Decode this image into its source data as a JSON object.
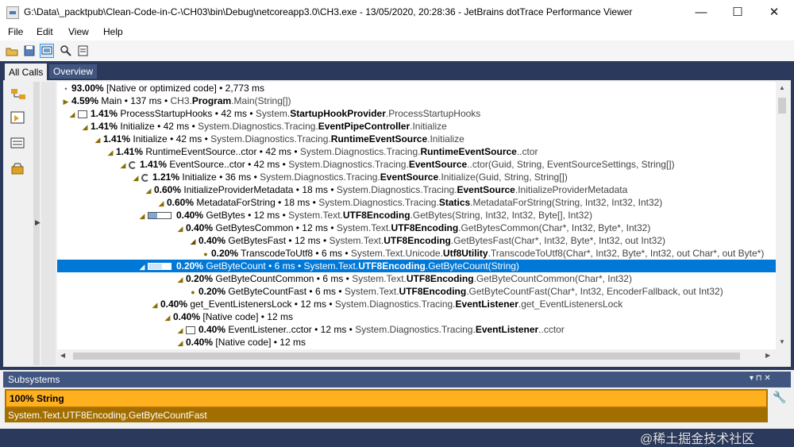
{
  "window": {
    "title": "G:\\Data\\_packtpub\\Clean-Code-in-C-\\CH03\\bin\\Debug\\netcoreapp3.0\\CH3.exe - 13/05/2020, 20:28:36 - JetBrains dotTrace Performance Viewer",
    "minimize": "—",
    "maximize": "☐",
    "close": "✕"
  },
  "menu": {
    "file": "File",
    "edit": "Edit",
    "view": "View",
    "help": "Help"
  },
  "tabs": {
    "all_calls": "All Calls",
    "overview": "Overview"
  },
  "tree": [
    {
      "icon": "none",
      "pct": "93.00%",
      "name": "[Native or optimized code]",
      "time": "2,773 ms",
      "ns": "",
      "cls": "",
      "method": ""
    },
    {
      "icon": "expand",
      "pct": "4.59%",
      "name": "Main",
      "time": "137 ms",
      "ns": "CH3.",
      "cls": "Program",
      "method": ".Main(String[])"
    },
    {
      "icon": "collapse",
      "pct": "1.41%",
      "name": "ProcessStartupHooks",
      "time": "42 ms",
      "ns": "System.",
      "cls": "StartupHookProvider",
      "method": ".ProcessStartupHooks"
    },
    {
      "icon": "collapse",
      "pct": "1.41%",
      "name": "Initialize",
      "time": "42 ms",
      "ns": "System.Diagnostics.Tracing.",
      "cls": "EventPipeController",
      "method": ".Initialize"
    },
    {
      "icon": "collapse",
      "pct": "1.41%",
      "name": "Initialize",
      "time": "42 ms",
      "ns": "System.Diagnostics.Tracing.",
      "cls": "RuntimeEventSource",
      "method": ".Initialize"
    },
    {
      "icon": "collapse",
      "pct": "1.41%",
      "name": "RuntimeEventSource..ctor",
      "time": "42 ms",
      "ns": "System.Diagnostics.Tracing.",
      "cls": "RuntimeEventSource",
      "method": "..ctor"
    },
    {
      "icon": "collapse",
      "pct": "1.41%",
      "name": "EventSource..ctor",
      "time": "42 ms",
      "ns": "System.Diagnostics.Tracing.",
      "cls": "EventSource",
      "method": "..ctor(Guid, String, EventSourceSettings, String[])"
    },
    {
      "icon": "collapse",
      "pct": "1.21%",
      "name": "Initialize",
      "time": "36 ms",
      "ns": "System.Diagnostics.Tracing.",
      "cls": "EventSource",
      "method": ".Initialize(Guid, String, String[])"
    },
    {
      "icon": "collapse",
      "pct": "0.60%",
      "name": "InitializeProviderMetadata",
      "time": "18 ms",
      "ns": "System.Diagnostics.Tracing.",
      "cls": "EventSource",
      "method": ".InitializeProviderMetadata"
    },
    {
      "icon": "collapse",
      "pct": "0.60%",
      "name": "MetadataForString",
      "time": "18 ms",
      "ns": "System.Diagnostics.Tracing.",
      "cls": "Statics",
      "method": ".MetadataForString(String, Int32, Int32, Int32)"
    },
    {
      "icon": "collapse",
      "pct": "0.40%",
      "name": "GetBytes",
      "time": "12 ms",
      "ns": "System.Text.",
      "cls": "UTF8Encoding",
      "method": ".GetBytes(String, Int32, Int32, Byte[], Int32)"
    },
    {
      "icon": "collapse",
      "pct": "0.40%",
      "name": "GetBytesCommon",
      "time": "12 ms",
      "ns": "System.Text.",
      "cls": "UTF8Encoding",
      "method": ".GetBytesCommon(Char*, Int32, Byte*, Int32)"
    },
    {
      "icon": "collapse-dark",
      "pct": "0.40%",
      "name": "GetBytesFast",
      "time": "12 ms",
      "ns": "System.Text.",
      "cls": "UTF8Encoding",
      "method": ".GetBytesFast(Char*, Int32, Byte*, Int32, out Int32)"
    },
    {
      "icon": "dot",
      "pct": "0.20%",
      "name": "TranscodeToUtf8",
      "time": "6 ms",
      "ns": "System.Text.Unicode.",
      "cls": "Utf8Utility",
      "method": ".TranscodeToUtf8(Char*, Int32, Byte*, Int32, out Char*, out Byte*)"
    },
    {
      "icon": "collapse",
      "pct": "0.20%",
      "name": "GetByteCount",
      "time": "6 ms",
      "ns": "System.Text.",
      "cls": "UTF8Encoding",
      "method": ".GetByteCount(String)",
      "selected": true
    },
    {
      "icon": "collapse",
      "pct": "0.20%",
      "name": "GetByteCountCommon",
      "time": "6 ms",
      "ns": "System.Text.",
      "cls": "UTF8Encoding",
      "method": ".GetByteCountCommon(Char*, Int32)"
    },
    {
      "icon": "dot",
      "pct": "0.20%",
      "name": "GetByteCountFast",
      "time": "6 ms",
      "ns": "System.Text.",
      "cls": "UTF8Encoding",
      "method": ".GetByteCountFast(Char*, Int32, EncoderFallback, out Int32)"
    },
    {
      "icon": "collapse",
      "pct": "0.40%",
      "name": "get_EventListenersLock",
      "time": "12 ms",
      "ns": "System.Diagnostics.Tracing.",
      "cls": "EventListener",
      "method": ".get_EventListenersLock"
    },
    {
      "icon": "collapse",
      "pct": "0.40%",
      "name": "[Native code]",
      "time": "12 ms",
      "ns": "",
      "cls": "",
      "method": ""
    },
    {
      "icon": "collapse",
      "pct": "0.40%",
      "name": "EventListener..cctor",
      "time": "12 ms",
      "ns": "System.Diagnostics.Tracing.",
      "cls": "EventListener",
      "method": "..cctor"
    },
    {
      "icon": "collapse",
      "pct": "0.40%",
      "name": "[Native code]",
      "time": "12 ms",
      "ns": "",
      "cls": "",
      "method": ""
    }
  ],
  "subsystems": {
    "title": "Subsystems",
    "pin": "▾ ⊓ ✕",
    "summary": "100% String",
    "detail": "System.Text.UTF8Encoding.GetByteCountFast"
  },
  "watermark": "@稀土掘金技术社区"
}
